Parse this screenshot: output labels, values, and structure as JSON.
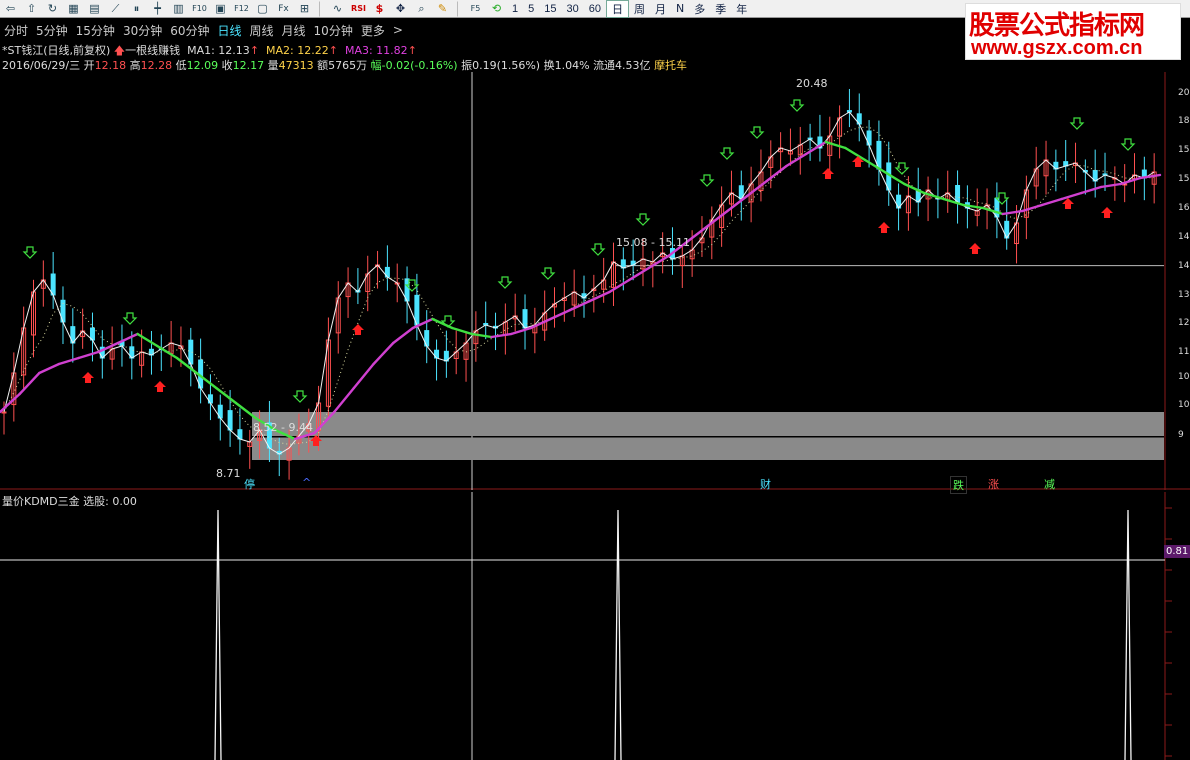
{
  "toolbar": {
    "numbers": [
      "1",
      "5",
      "15",
      "30",
      "60"
    ],
    "tabs": [
      "日",
      "周",
      "月",
      "N",
      "多",
      "季",
      "年"
    ],
    "icons": [
      "back-arrow-icon",
      "up-arrow-icon",
      "refresh-icon",
      "chart-grid-icon",
      "table-icon",
      "line-chart-icon",
      "pause-icon",
      "candle-icon",
      "tick-icon",
      "f10-icon",
      "text-icon",
      "note-icon",
      "fenshi-icon",
      "fx-icon",
      "tools-icon",
      "rsi-icon",
      "dollar-icon",
      "cross-move-icon",
      "zoom-icon",
      "pencil-icon",
      "f5-icon",
      "cycle-icon"
    ],
    "labels": {
      "rsi": "RSI",
      "f5": "F5",
      "f10": "F10",
      "fx": "Fx",
      "f12": "F12",
      "dollar": "$"
    }
  },
  "watermark": {
    "title": "股票公式指标网",
    "url": "www.gszx.com.cn"
  },
  "periods": {
    "items": [
      "分时",
      "5分钟",
      "15分钟",
      "30分钟",
      "60分钟",
      "日线",
      "周线",
      "月线",
      "10分钟",
      "更多"
    ],
    "active": "日线",
    "more_glyph": ">"
  },
  "stock": {
    "name": "*ST钱江(日线,前复权)",
    "indicator": "一根线赚钱",
    "ma1": "MA1: 12.13",
    "ma2": "MA2: 12.22",
    "ma3": "MA3: 11.82",
    "date": "2016/06/29/三",
    "open_label": "开",
    "open": "12.18",
    "high_label": "高",
    "high": "12.28",
    "low_label": "低",
    "low": "12.09",
    "close_label": "收",
    "close": "12.17",
    "vol_label": "量",
    "volume": "47313",
    "amount": "额5765万",
    "change": "幅-0.02(-0.16%)",
    "amplitude": "振0.19(1.56%)",
    "turnover": "换1.04%",
    "float": "流通4.53亿",
    "sector": "摩托车"
  },
  "annotations": {
    "high_price": "20.48",
    "low_price": "8.71",
    "band_upper": "15.08 - 15.11",
    "band_lower": "8.52 - 9.44"
  },
  "events": [
    {
      "label": "停",
      "color": "#4be4ff"
    },
    {
      "label": "^",
      "color": "#4b6bff"
    },
    {
      "label": "财",
      "color": "#4be4ff"
    },
    {
      "label": "跌",
      "color": "#5aff5a"
    },
    {
      "label": "涨",
      "color": "#ff5050"
    },
    {
      "label": "减",
      "color": "#5aff5a"
    }
  ],
  "sub_indicator": {
    "title": "量价KDMD三金 选股: 0.00",
    "reading": "0.81"
  },
  "y_axis": {
    "ticks": [
      "20",
      "18",
      "15",
      "15",
      "16",
      "14",
      "14",
      "13",
      "12",
      "11",
      "10",
      "10",
      "9"
    ]
  },
  "colors": {
    "up": "#ff5050",
    "down": "#4be4ff",
    "ma_rise": "#d040d0",
    "ma_fall": "#40e040",
    "arrow_up": "#ff2020",
    "arrow_down": "#40e040",
    "band": "#8a8a8a"
  },
  "chart_data": {
    "type": "line",
    "ylim": [
      8,
      21
    ],
    "closes": [
      10.2,
      11.5,
      13.0,
      14.2,
      14.6,
      14.1,
      13.2,
      12.5,
      12.9,
      12.6,
      12.0,
      12.3,
      12.4,
      12.0,
      12.2,
      12.1,
      12.3,
      12.5,
      12.4,
      11.8,
      11.0,
      10.5,
      10.0,
      9.6,
      9.3,
      9.2,
      9.6,
      9.0,
      8.8,
      9.0,
      9.4,
      9.8,
      10.5,
      12.6,
      14.0,
      14.5,
      14.2,
      14.8,
      15.1,
      14.7,
      14.5,
      13.9,
      13.1,
      12.4,
      12.0,
      11.9,
      12.2,
      12.5,
      12.9,
      13.1,
      13.0,
      13.2,
      13.4,
      13.0,
      13.1,
      13.5,
      13.8,
      14.0,
      14.2,
      14.0,
      14.3,
      14.6,
      15.2,
      15.0,
      15.1,
      15.3,
      15.2,
      15.5,
      15.3,
      15.4,
      15.6,
      16.0,
      16.6,
      17.1,
      17.5,
      17.3,
      17.8,
      18.2,
      18.7,
      19.0,
      18.9,
      19.1,
      19.3,
      19.0,
      19.4,
      20.0,
      20.2,
      19.8,
      19.1,
      18.3,
      17.6,
      17.0,
      17.4,
      17.2,
      17.6,
      17.3,
      17.5,
      17.2,
      17.0,
      16.9,
      17.1,
      16.7,
      16.0,
      16.5,
      17.6,
      18.3,
      18.6,
      18.3,
      18.4,
      18.5,
      18.2,
      17.9,
      18.1,
      18.0,
      17.8,
      18.1,
      18.0,
      18.2
    ],
    "ma3": [
      10.2,
      10.8,
      11.5,
      11.8,
      12.0,
      12.2,
      12.5,
      12.8,
      12.4,
      12.0,
      11.5,
      11.0,
      10.5,
      10.0,
      9.6,
      9.3,
      9.5,
      10.2,
      11.0,
      11.8,
      12.5,
      13.0,
      13.3,
      13.0,
      12.8,
      12.7,
      12.8,
      13.0,
      13.3,
      13.6,
      13.9,
      14.2,
      14.6,
      15.0,
      15.4,
      15.9,
      16.4,
      16.9,
      17.4,
      17.9,
      18.4,
      18.8,
      19.2,
      19.0,
      18.6,
      18.2,
      17.8,
      17.5,
      17.3,
      17.1,
      17.0,
      16.8,
      16.9,
      17.1,
      17.3,
      17.5,
      17.7,
      17.8,
      18.0,
      18.1
    ],
    "ma_rise_flags": [
      1,
      1,
      1,
      1,
      1,
      1,
      1,
      1,
      0,
      0,
      0,
      0,
      0,
      0,
      0,
      0,
      1,
      1,
      1,
      1,
      1,
      1,
      1,
      0,
      0,
      0,
      1,
      1,
      1,
      1,
      1,
      1,
      1,
      1,
      1,
      1,
      1,
      1,
      1,
      1,
      1,
      1,
      1,
      0,
      0,
      0,
      0,
      0,
      0,
      0,
      0,
      0,
      1,
      1,
      1,
      1,
      1,
      1,
      1,
      1
    ],
    "band_upper_value": [
      15.08,
      15.11
    ],
    "band_lower_value": [
      8.52,
      9.44
    ],
    "signal_spikes": [
      218,
      618,
      1128
    ],
    "sub_level": 0.81
  }
}
